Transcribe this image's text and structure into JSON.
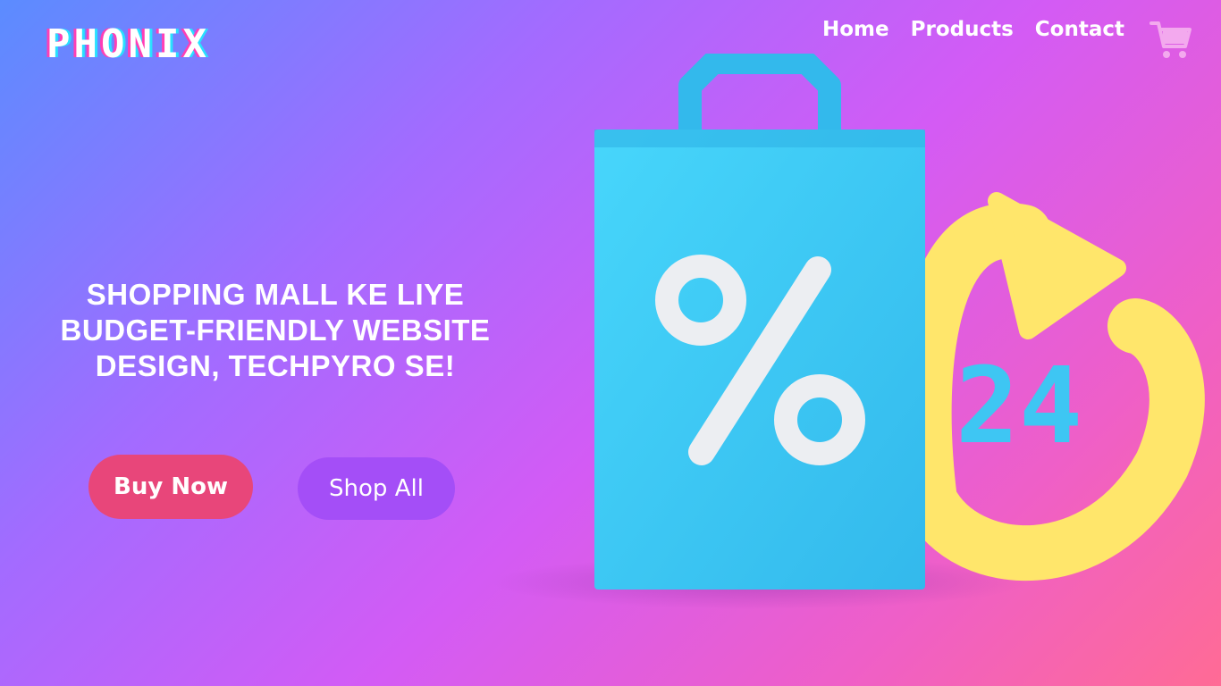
{
  "brand": {
    "logo_text": "PHONIX"
  },
  "nav": {
    "items": [
      "Home",
      "Products",
      "Contact"
    ]
  },
  "cart": {
    "icon": "shopping-cart-icon"
  },
  "hero": {
    "headline": [
      "SHOPPING MALL KE LIYE",
      "BUDGET-FRIENDLY WEBSITE",
      "DESIGN, TECHPYRO SE!"
    ],
    "buttons": {
      "buy_now": "Buy Now",
      "shop_all": "Shop All"
    }
  },
  "illustration": {
    "bag_icon": "shopping-bag-percent-icon",
    "percent_glyph": "%",
    "badge_text": "24"
  },
  "colors": {
    "buy_button": "#e8467a",
    "shop_button": "#a44ef7",
    "bag": "#3ec6f3",
    "arrow": "#ffe66b"
  }
}
